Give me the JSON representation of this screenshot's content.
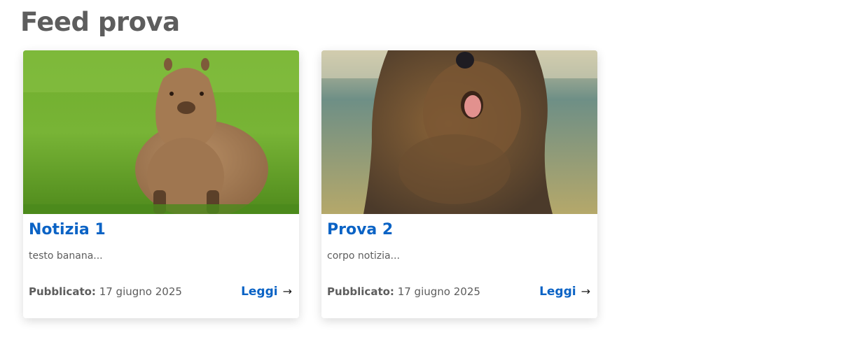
{
  "page": {
    "title": "Feed prova"
  },
  "cards": [
    {
      "title": "Notizia 1",
      "excerpt": "testo banana...",
      "published_label": "Pubblicato:",
      "published_date": "17 giugno 2025",
      "read_label": "Leggi",
      "image_icon": "capybara-photo"
    },
    {
      "title": "Prova 2",
      "excerpt": "corpo notizia...",
      "published_label": "Pubblicato:",
      "published_date": "17 giugno 2025",
      "read_label": "Leggi",
      "image_icon": "quokka-photo"
    }
  ],
  "colors": {
    "title": "#5d5d5d",
    "link": "#0b63c5",
    "text": "#5d5d5d"
  }
}
